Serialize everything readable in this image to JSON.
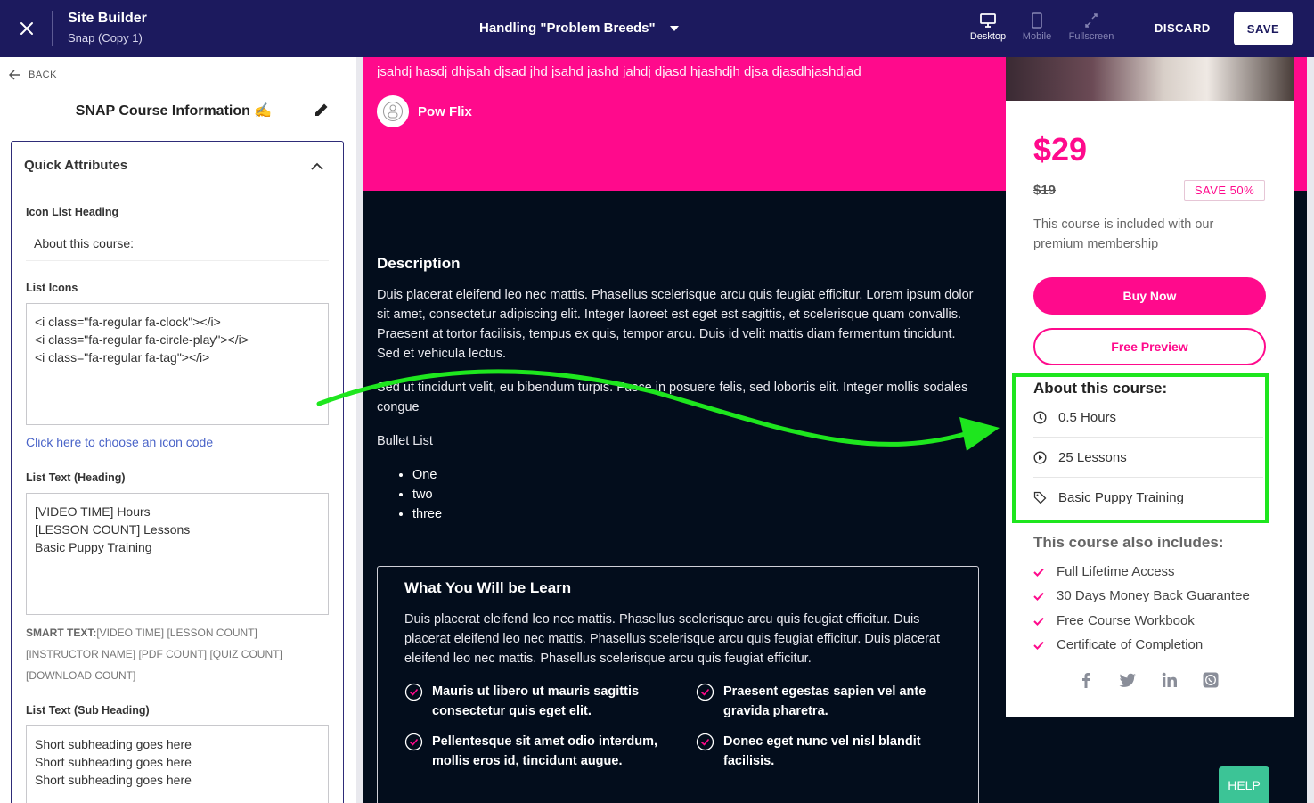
{
  "topbar": {
    "title": "Site Builder",
    "subtitle": "Snap (Copy 1)",
    "page_selector": "Handling \"Problem Breeds\"",
    "devices": [
      {
        "label": "Desktop",
        "icon": "desktop-icon",
        "active": true
      },
      {
        "label": "Mobile",
        "icon": "mobile-icon",
        "active": false
      },
      {
        "label": "Fullscreen",
        "icon": "fullscreen-icon",
        "active": false
      }
    ],
    "discard_label": "DISCARD",
    "save_label": "SAVE"
  },
  "left_panel": {
    "back_label": "BACK",
    "title": "SNAP Course Information ✍️",
    "section_title": "Quick Attributes",
    "icon_list_heading_label": "Icon List Heading",
    "icon_list_heading_value": "About this course:",
    "list_icons_label": "List Icons",
    "list_icons_value": "<i class=\"fa-regular fa-clock\"></i>\n<i class=\"fa-regular fa-circle-play\"></i>\n<i class=\"fa-regular fa-tag\"></i>",
    "icon_code_link": "Click here to choose an icon code",
    "list_text_heading_label": "List Text (Heading)",
    "list_text_heading_value": "[VIDEO TIME] Hours\n[LESSON COUNT] Lessons\nBasic Puppy Training",
    "smart_text_label": "SMART TEXT:",
    "smart_text_value": "[VIDEO TIME] [LESSON COUNT] [INSTRUCTOR NAME] [PDF COUNT] [QUIZ COUNT] [DOWNLOAD COUNT]",
    "list_text_sub_label": "List Text (Sub Heading)",
    "list_text_sub_value": "Short subheading goes here\nShort subheading goes here\nShort subheading goes here"
  },
  "preview": {
    "hero_text": "jsahdj hasdj dhjsah djsad jhd jsahd jashd jahdj djasd hjashdjh djsa djasdhjashdjad",
    "author_name": "Pow Flix",
    "description_heading": "Description",
    "description_p1": "Duis placerat eleifend leo nec mattis. Phasellus scelerisque arcu quis feugiat efficitur. Lorem ipsum dolor sit amet, consectetur adipiscing elit. Integer laoreet est eget est sagittis, et scelerisque quam convallis. Praesent at tortor facilisis, tempus ex quis, tempor arcu. Duis id velit mattis diam fermentum tincidunt. Sed et vehicula lectus.",
    "description_p2": "Sed ut tincidunt velit, eu bibendum turpis. Fusce in posuere felis, sed lobortis elit. Integer mollis sodales congue",
    "bullet_heading": "Bullet List",
    "bullets": [
      "One",
      "two",
      "three"
    ],
    "learn_heading": "What You Will be Learn",
    "learn_text": "Duis placerat eleifend leo nec mattis. Phasellus scelerisque arcu quis feugiat efficitur. Duis placerat eleifend leo nec mattis. Phasellus scelerisque arcu quis feugiat efficitur. Duis placerat eleifend leo nec mattis. Phasellus scelerisque arcu quis feugiat efficitur.",
    "learn_items": [
      "Mauris ut libero ut mauris sagittis consectetur quis eget elit.",
      "Praesent egestas sapien vel ante gravida pharetra.",
      "Pellentesque sit amet odio interdum, mollis eros id, tincidunt augue.",
      "Donec eget nunc vel nisl blandit facilisis."
    ]
  },
  "card": {
    "price": "$29",
    "old_price": "$19",
    "save_badge": "SAVE 50%",
    "included_text": "This course is included with our premium membership",
    "buy_label": "Buy Now",
    "preview_label": "Free Preview",
    "about_heading": "About this course:",
    "about_items": [
      {
        "icon": "clock-icon",
        "text": "0.5 Hours"
      },
      {
        "icon": "play-circle-icon",
        "text": "25 Lessons"
      },
      {
        "icon": "tag-icon",
        "text": "Basic Puppy Training"
      }
    ],
    "also_heading": "This course also includes:",
    "also_items": [
      "Full Lifetime Access",
      "30 Days Money Back Guarantee",
      "Free Course Workbook",
      "Certificate of Completion"
    ],
    "socials": [
      "facebook-icon",
      "twitter-icon",
      "linkedin-icon",
      "whatsapp-icon"
    ]
  },
  "help_label": "HELP",
  "colors": {
    "brand_dark": "#1c1a5e",
    "accent_pink": "#ff0a8c",
    "highlight_green": "#1ee61e",
    "help_green": "#3cc496"
  }
}
